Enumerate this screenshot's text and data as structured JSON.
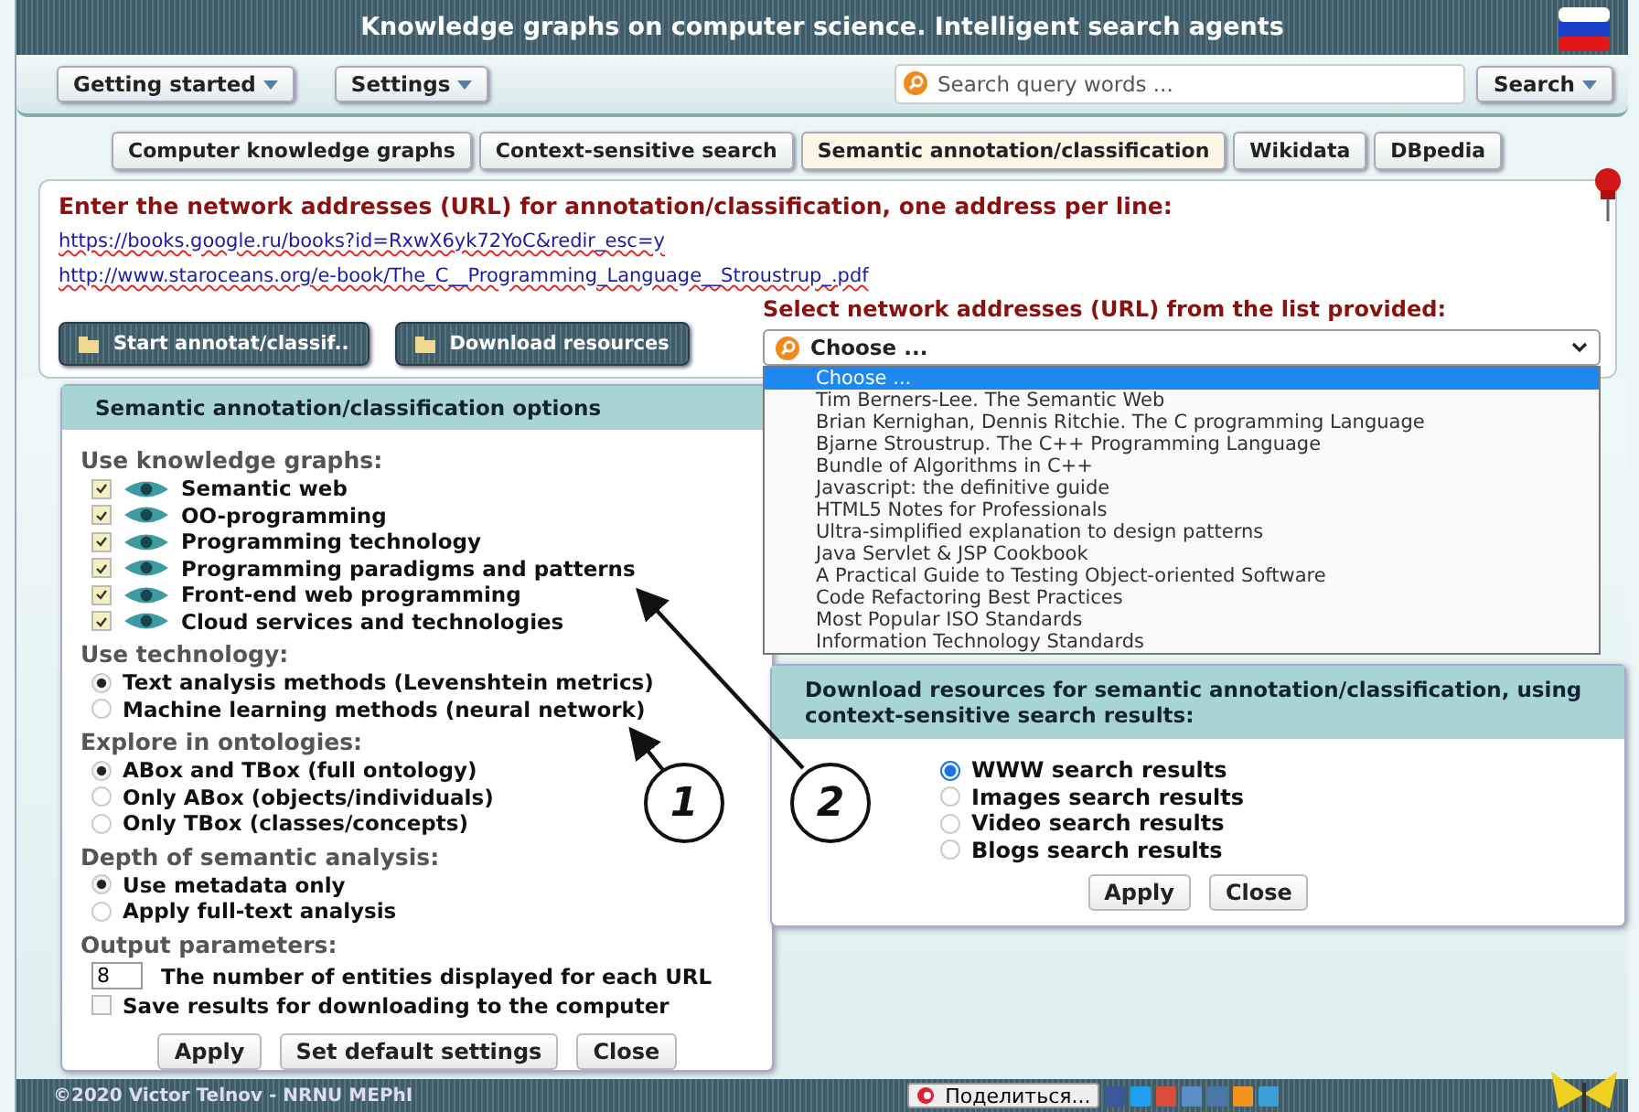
{
  "window": {
    "title": "Knowledge graphs on computer science. Intelligent search agents"
  },
  "toolbar": {
    "menus": [
      {
        "label": "Getting started"
      },
      {
        "label": "Settings"
      }
    ],
    "search": {
      "placeholder": "Search query words ..."
    },
    "search_button": "Search"
  },
  "tabs": [
    {
      "label": "Computer knowledge graphs",
      "selected": false
    },
    {
      "label": "Context-sensitive search",
      "selected": false
    },
    {
      "label": "Semantic annotation/classification",
      "selected": true
    },
    {
      "label": "Wikidata",
      "selected": false
    },
    {
      "label": "DBpedia",
      "selected": false
    }
  ],
  "url_panel": {
    "heading": "Enter the network addresses (URL) for annotation/classification, one address per line:",
    "urls": [
      "https://books.google.ru/books?id=RxwX6yk72YoC&redir_esc=y",
      "http://www.staroceans.org/e-book/The_C__Programming_Language__Stroustrup_.pdf"
    ],
    "start_button": "Start annotat/classif..",
    "download_button": "Download resources",
    "select_label": "Select network addresses (URL) from the list provided:",
    "select_value": "Choose ..."
  },
  "dropdown": {
    "options": [
      {
        "label": "Choose ...",
        "selected": true
      },
      {
        "label": "Tim Berners-Lee. The Semantic Web",
        "selected": false
      },
      {
        "label": "Brian Kernighan, Dennis Ritchie. The C programming Language",
        "selected": false
      },
      {
        "label": "Bjarne Stroustrup. The C++ Programming Language",
        "selected": false
      },
      {
        "label": "Bundle of Algorithms in C++",
        "selected": false
      },
      {
        "label": "Javascript: the definitive guide",
        "selected": false
      },
      {
        "label": "HTML5 Notes for Professionals",
        "selected": false
      },
      {
        "label": "Ultra-simplified explanation to design patterns",
        "selected": false
      },
      {
        "label": "Java Servlet & JSP Cookbook",
        "selected": false
      },
      {
        "label": "A Practical Guide to Testing Object-oriented Software",
        "selected": false
      },
      {
        "label": "Code Refactoring Best Practices",
        "selected": false
      },
      {
        "label": "Most Popular ISO Standards",
        "selected": false
      },
      {
        "label": "Information Technology Standards",
        "selected": false
      }
    ]
  },
  "options_dialog": {
    "title": "Semantic annotation/classification options",
    "sections": [
      {
        "title": "Use knowledge graphs:",
        "items": [
          {
            "kind": "graph",
            "label": "Semantic web",
            "checked": true
          },
          {
            "kind": "graph",
            "label": "OO-programming",
            "checked": true
          },
          {
            "kind": "graph",
            "label": "Programming technology",
            "checked": true
          },
          {
            "kind": "graph",
            "label": "Programming paradigms and patterns",
            "checked": true
          },
          {
            "kind": "graph",
            "label": "Front-end web programming",
            "checked": true
          },
          {
            "kind": "graph",
            "label": "Cloud services and technologies",
            "checked": true
          }
        ]
      },
      {
        "title": "Use technology:",
        "items": [
          {
            "kind": "radio",
            "label": "Text analysis methods (Levenshtein metrics)",
            "selected": true
          },
          {
            "kind": "radio",
            "label": "Machine learning methods (neural network)",
            "selected": false
          }
        ]
      },
      {
        "title": "Explore in ontologies:",
        "items": [
          {
            "kind": "radio",
            "label": "ABox and TBox (full ontology)",
            "selected": true
          },
          {
            "kind": "radio",
            "label": "Only ABox (objects/individuals)",
            "selected": false
          },
          {
            "kind": "radio",
            "label": "Only TBox (classes/concepts)",
            "selected": false
          }
        ]
      },
      {
        "title": "Depth of semantic analysis:",
        "items": [
          {
            "kind": "radio",
            "label": "Use metadata only",
            "selected": true
          },
          {
            "kind": "radio",
            "label": "Apply full-text analysis",
            "selected": false
          }
        ]
      },
      {
        "title": "Output parameters:",
        "items": [
          {
            "kind": "number",
            "value": "8",
            "label": "The number of entities displayed for each URL"
          },
          {
            "kind": "checkbox",
            "label": "Save results for downloading to the computer",
            "checked": false
          }
        ]
      }
    ],
    "buttons": [
      "Apply",
      "Set default settings",
      "Close"
    ]
  },
  "download_dialog": {
    "title": "Download resources for semantic annotation/classification, using context-sensitive search results:",
    "options": [
      {
        "label": "WWW search results",
        "selected": true
      },
      {
        "label": "Images search results",
        "selected": false
      },
      {
        "label": "Video search results",
        "selected": false
      },
      {
        "label": "Blogs search results",
        "selected": false
      }
    ],
    "buttons": [
      "Apply",
      "Close"
    ]
  },
  "footer": {
    "copyright": "©2020 Victor Telnov - NRNU MEPhI",
    "share": "Поделиться..."
  },
  "callouts": [
    {
      "label": "1"
    },
    {
      "label": "2"
    }
  ]
}
